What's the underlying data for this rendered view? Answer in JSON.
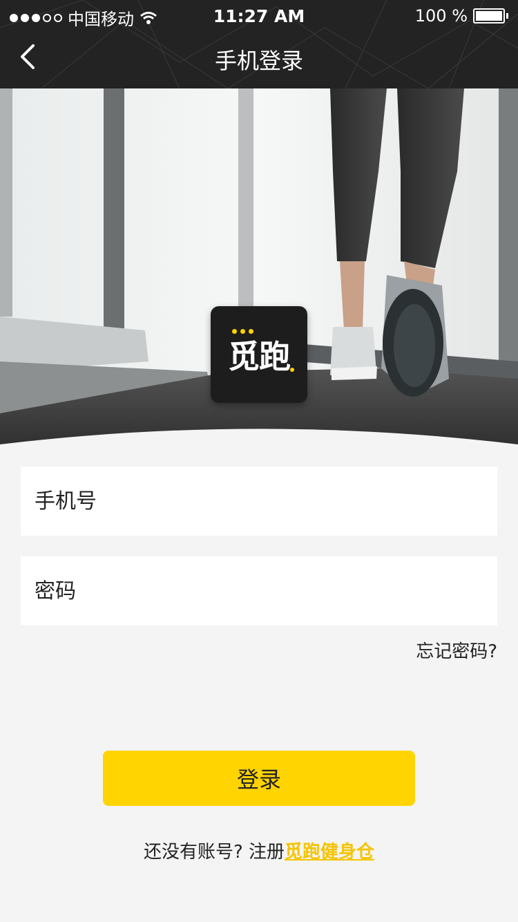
{
  "status_bar": {
    "carrier": "中国移动",
    "time": "11:27 AM",
    "battery": "100 %"
  },
  "header": {
    "title": "手机登录",
    "back_icon": "chevron-left-icon"
  },
  "logo": {
    "text": "觅跑"
  },
  "form": {
    "phone_placeholder": "手机号",
    "password_placeholder": "密码",
    "forgot": "忘记密码?"
  },
  "actions": {
    "login": "登录",
    "register_prefix": "还没有账号? 注册",
    "register_link": "觅跑健身仓"
  },
  "colors": {
    "accent": "#ffd400",
    "header_bg": "#232323",
    "page_bg": "#f4f4f4"
  }
}
